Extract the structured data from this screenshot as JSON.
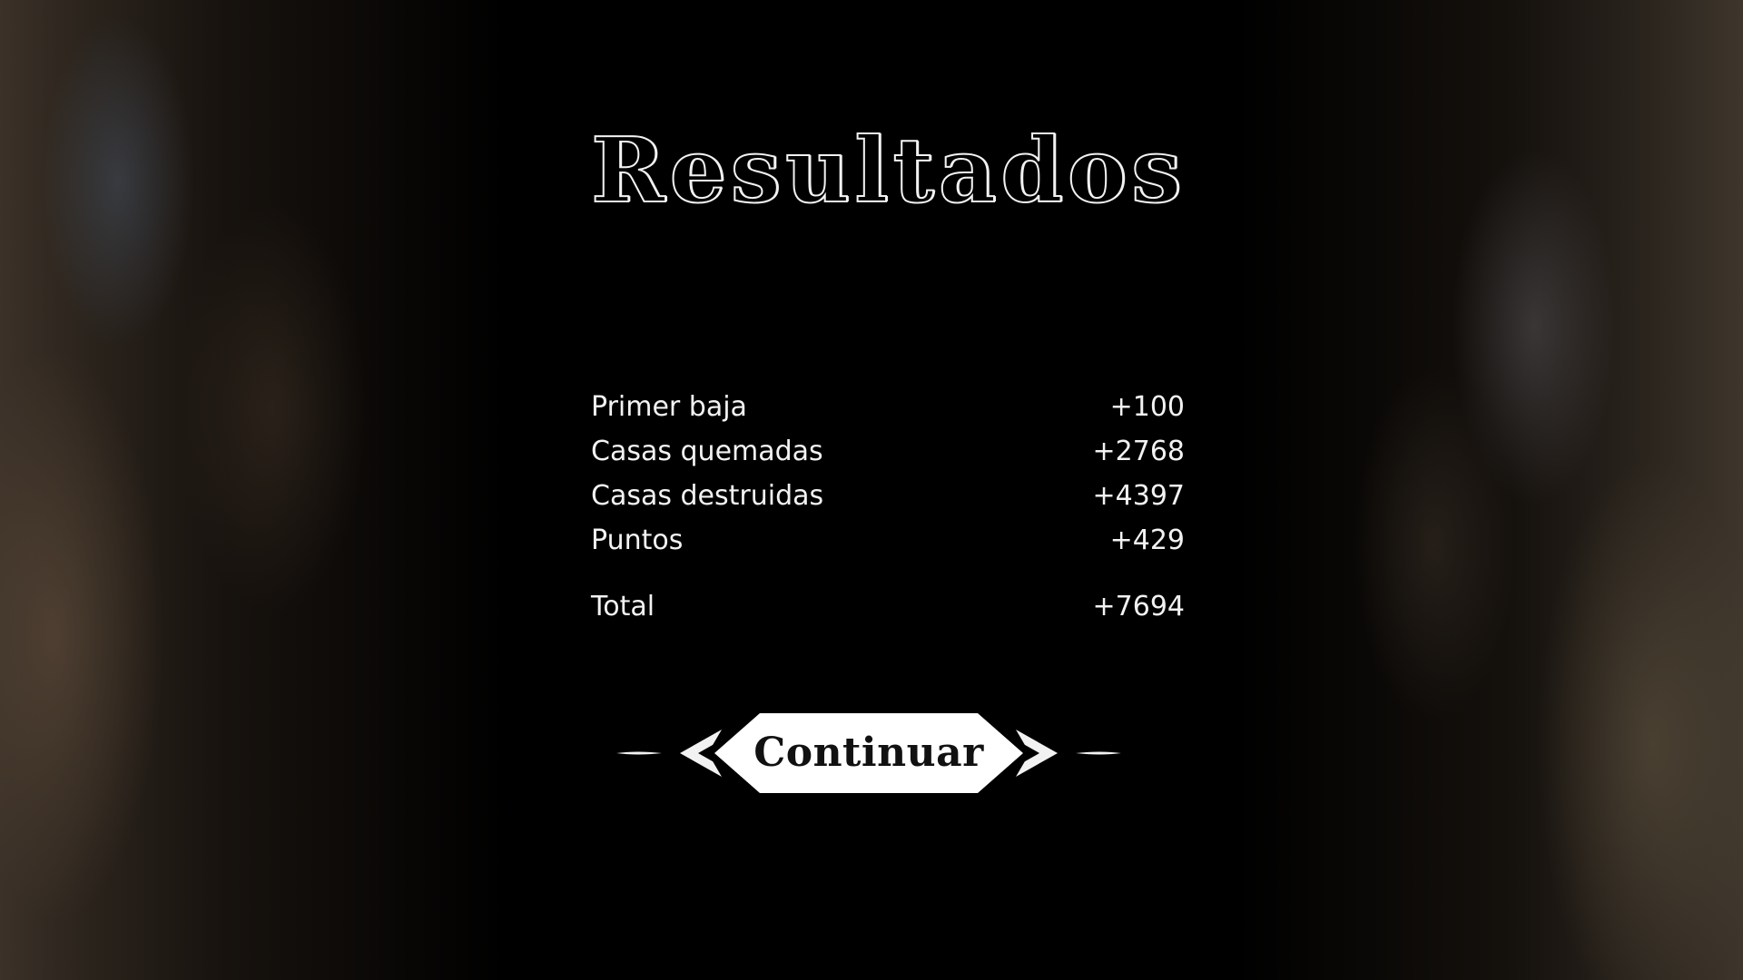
{
  "screen": {
    "title": "Resultados"
  },
  "results": {
    "rows": [
      {
        "label": "Primer baja",
        "value": "+100"
      },
      {
        "label": "Casas quemadas",
        "value": "+2768"
      },
      {
        "label": "Casas destruidas",
        "value": "+4397"
      },
      {
        "label": "Puntos",
        "value": "+429"
      }
    ],
    "total": {
      "label": "Total",
      "value": "+7694"
    }
  },
  "actions": {
    "continue_label": "Continuar"
  },
  "colors": {
    "background": "#000000",
    "text": "#f2f2f2",
    "button_fill": "#ffffff",
    "button_text": "#111111"
  },
  "icons": {
    "continue_ornament": "ornate-arrow-frame-icon"
  }
}
